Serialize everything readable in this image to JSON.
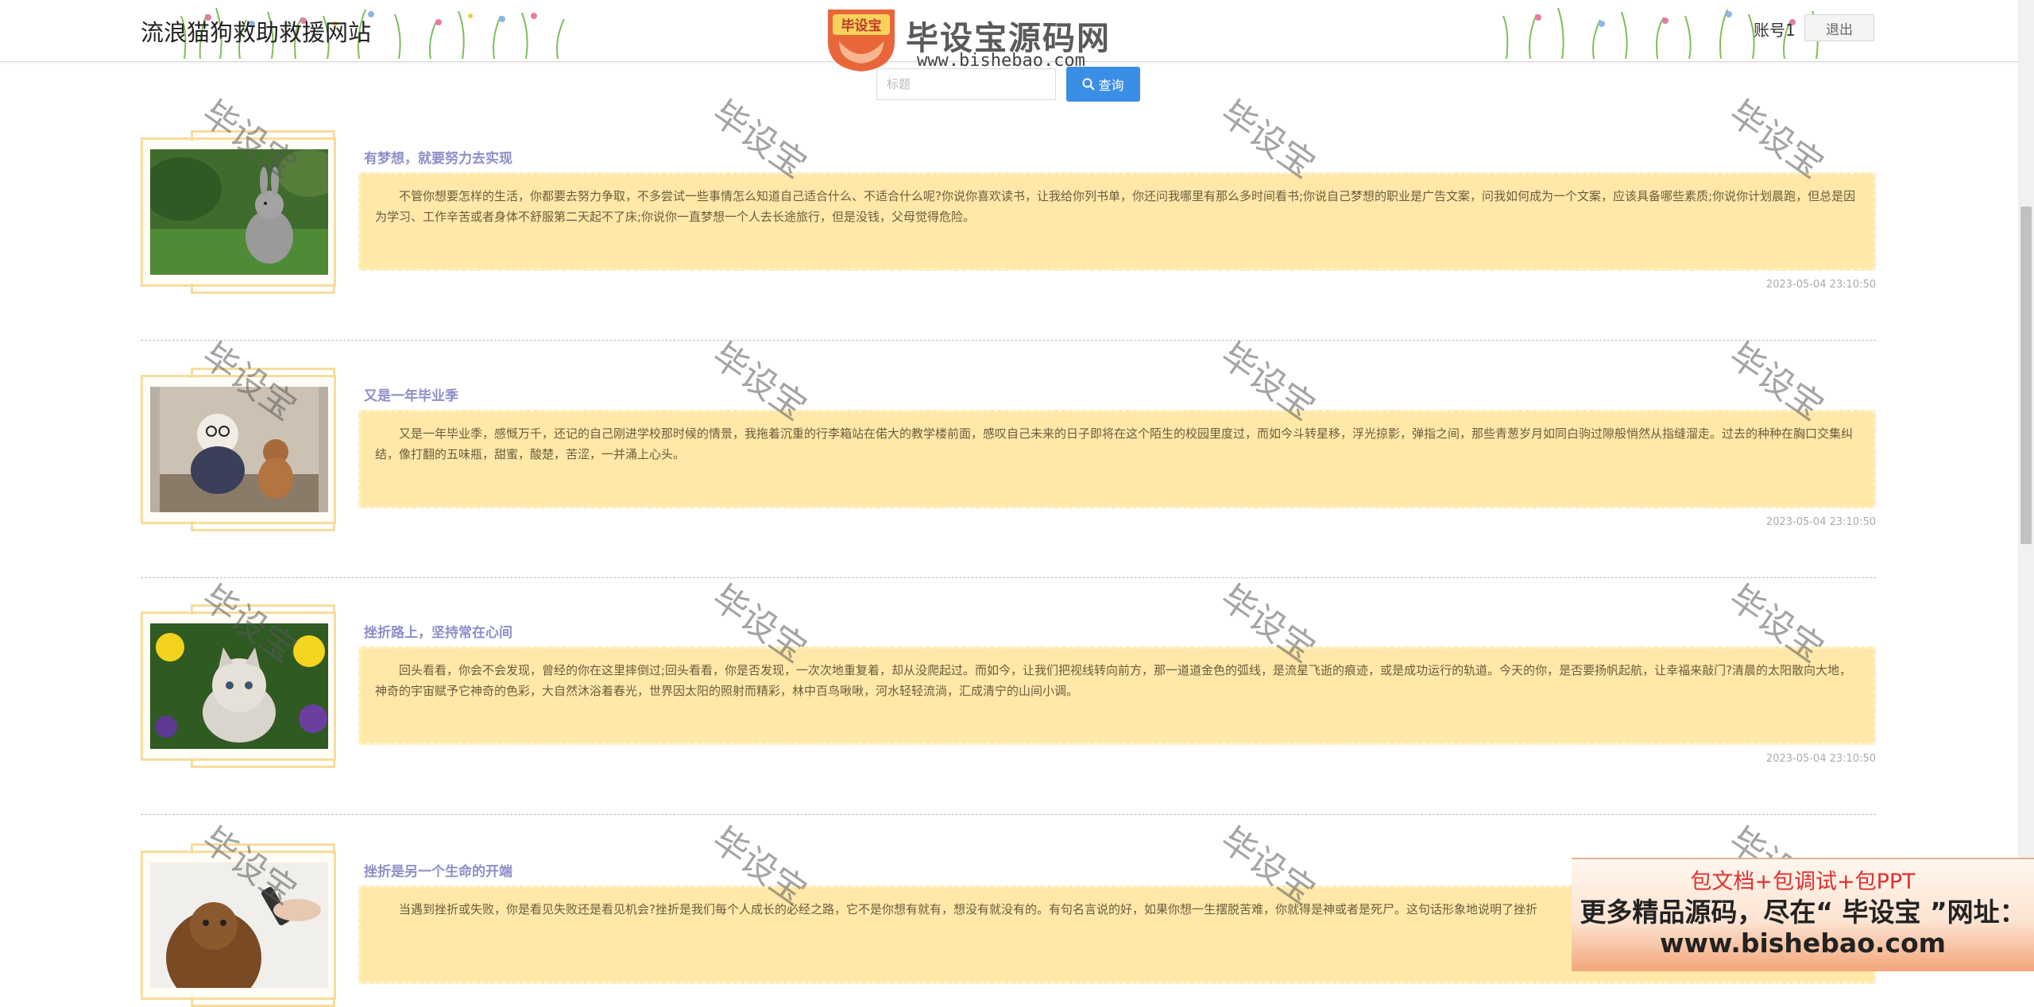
{
  "header": {
    "site_title": "流浪猫狗救助救援网站",
    "account": "账号1",
    "logout_label": "退出"
  },
  "banner": {
    "badge_text": "毕设宝",
    "name": "毕设宝源码网",
    "url": "www.bishebao.com"
  },
  "search": {
    "placeholder": "标题",
    "button_label": "查询",
    "button_icon": "search-icon"
  },
  "articles": [
    {
      "title": "有梦想，就要努力去实现",
      "content": "不管你想要怎样的生活，你都要去努力争取，不多尝试一些事情怎么知道自己适合什么、不适合什么呢?你说你喜欢读书，让我给你列书单，你还问我哪里有那么多时间看书;你说自己梦想的职业是广告文案，问我如何成为一个文案，应该具备哪些素质;你说你计划晨跑，但总是因为学习、工作辛苦或者身体不舒服第二天起不了床;你说你一直梦想一个人去长途旅行，但是没钱，父母觉得危险。",
      "date": "2023-05-04 23:10:50",
      "image": "rabbit-photo"
    },
    {
      "title": "又是一年毕业季",
      "content": "又是一年毕业季，感慨万千，还记的自己刚进学校那时候的情景，我拖着沉重的行李箱站在偌大的教学楼前面，感叹自己未来的日子即将在这个陌生的校园里度过，而如今斗转星移，浮光掠影，弹指之间，那些青葱岁月如同白驹过隙般悄然从指缝溜走。过去的种种在胸口交集纠结，像打翻的五味瓶，甜蜜，酸楚，苦涩，一并涌上心头。",
      "date": "2023-05-04 23:10:50",
      "image": "dog-and-cat-photo"
    },
    {
      "title": "挫折路上，坚持常在心间",
      "content": "回头看看，你会不会发现，曾经的你在这里摔倒过;回头看看，你是否发现，一次次地重复着，却从没爬起过。而如今，让我们把视线转向前方，那一道道金色的弧线，是流星飞逝的痕迹，或是成功运行的轨道。今天的你，是否要扬帆起航，让幸福来敲门?清晨的太阳散向大地，神奇的宇宙赋予它神奇的色彩，大自然沐浴着春光，世界因太阳的照射而精彩，林中百鸟啾啾，河水轻轻流淌，汇成清宁的山间小调。",
      "date": "2023-05-04 23:10:50",
      "image": "kitten-photo"
    },
    {
      "title": "挫折是另一个生命的开端",
      "content": "当遇到挫折或失败，你是看见失败还是看见机会?挫折是我们每个人成长的必经之路，它不是你想有就有，想没有就没有的。有句名言说的好，如果你想一生摆脱苦难，你就得是神或者是死尸。这句话形象地说明了挫折",
      "date": "",
      "image": "yorkie-photo"
    }
  ],
  "watermark": "毕设宝",
  "ad": {
    "line1": "包文档+包调试+包PPT",
    "line2": "更多精品源码，尽在“ 毕设宝 ”网址：",
    "line3": "www.bishebao.com"
  },
  "colors": {
    "title_purple": "#8e8ec9",
    "content_bg": "#ffe8a8",
    "frame_gold": "#f7dd9c",
    "search_blue": "#3a8ee6",
    "ad_red": "#e03030"
  }
}
